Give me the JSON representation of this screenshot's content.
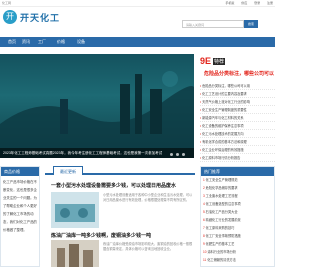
{
  "topbar": {
    "left": "化工网",
    "links": [
      "手机版",
      "供应",
      "登录",
      "注册"
    ]
  },
  "logo": {
    "mark": "开",
    "name": "开天化工"
  },
  "search": {
    "placeholder": "请输入关键词",
    "button": "搜索"
  },
  "nav": {
    "items": [
      "首页",
      "资讯",
      "工厂",
      "价格",
      "设备"
    ]
  },
  "banner": {
    "caption": "2023年化工工程师基础考试真题2023年，我今年考注册化工工程师基础考试，这也是我第一次参加考试"
  },
  "ad": {
    "tag": "9E",
    "tag2": "特荐"
  },
  "headline": "危险品分类标注，哪些公司可以用",
  "news": [
    "危险品分类标注，哪些公司可以用",
    "化工工艺设计的主要内容及要求",
    "天然气价格上涨对化工行业的影响",
    "化工安全生产管理制度的重要性",
    "新能源汽车与化工材料的关系",
    "化工设备的维护保养注意事项",
    "化工污水处理技术的发展方向",
    "有机化学合成的基本方法和原理",
    "化工企业环保治理的有效措施",
    "化工原料市场行情分析报告"
  ],
  "side_left": {
    "header": "商品价格",
    "text": "化工产品市场价格在不断变化，这也是很多企业关注的一个问题。为了帮助企业和个人更好的了解化工市场的动态，我们对化工产品的价格做了整理。"
  },
  "tabs": {
    "active": "最近更新"
  },
  "articles": [
    {
      "title": "一套小型污水处理设备需要多少钱，可以处理日用品废水",
      "text": "小型污水处理设备适用于各种中小型企业和生活污水处理，可以对日用品废水进行有效处理，价格根据处理量不同有所区别。"
    },
    {
      "title": "炼油厂油库一吨多少钱啊，废铜油多少钱一吨",
      "text": "炼油厂油库价格受原油市场影响较大，废铜油的回收价格一般根据含铜量来定，具体价格可以咨询当地回收企业。"
    }
  ],
  "right_box": {
    "header": "热门推荐",
    "rows": [
      "化工安全生产管理规范",
      "危险化学品储存的要求",
      "工业废水处理工艺流程",
      "化工设备选型的注意事项",
      "石油化工产品分类大全",
      "精细化工行业的发展前景",
      "化工原料采购的技巧",
      "化工厂安全事故预防措施",
      "化肥生产的基本工艺",
      "涂料行业的市场分析",
      "化工储罐的清洗方法"
    ]
  }
}
